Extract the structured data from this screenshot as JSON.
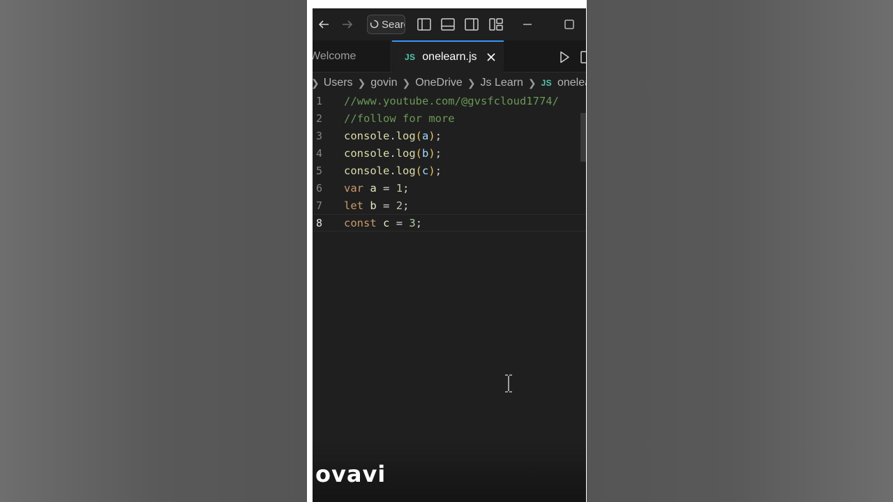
{
  "titlebar": {
    "back_icon": "arrow-left-icon",
    "forward_icon": "arrow-right-icon",
    "search_label": "Searc",
    "layout_icons": [
      "toggle-primary-sidebar-icon",
      "toggle-panel-icon",
      "toggle-secondary-sidebar-icon",
      "customize-layout-icon"
    ],
    "minimize_icon": "minimize-icon",
    "maximize_icon": "maximize-icon"
  },
  "tabs": [
    {
      "label": "Welcome",
      "active": false
    },
    {
      "label": "onelearn.js",
      "badge": "JS",
      "active": true
    }
  ],
  "breadcrumb": {
    "items": [
      "Users",
      "govin",
      "OneDrive",
      "Js Learn"
    ],
    "file_badge": "JS",
    "file": "onelearn"
  },
  "editor": {
    "lines": [
      {
        "num": "1",
        "text": "//www.youtube.com/@gvsfcloud1774/"
      },
      {
        "num": "2",
        "text": "//follow for more"
      },
      {
        "num": "3",
        "obj": "console",
        "fn": "log",
        "arg": "a"
      },
      {
        "num": "4",
        "obj": "console",
        "fn": "log",
        "arg": "b"
      },
      {
        "num": "5",
        "obj": "console",
        "fn": "log",
        "arg": "c"
      },
      {
        "num": "6",
        "kw": "var",
        "name": "a",
        "value": "1"
      },
      {
        "num": "7",
        "kw": "let",
        "name": "b",
        "value": "2"
      },
      {
        "num": "8",
        "kw": "const",
        "name": "c",
        "value": "3"
      }
    ],
    "active_line": "8"
  },
  "watermark": "ovavi",
  "colors": {
    "comment": "#6a9955",
    "keyword": "#c99a6a",
    "accent": "#3794ff",
    "js_badge": "#4ec9b0"
  }
}
